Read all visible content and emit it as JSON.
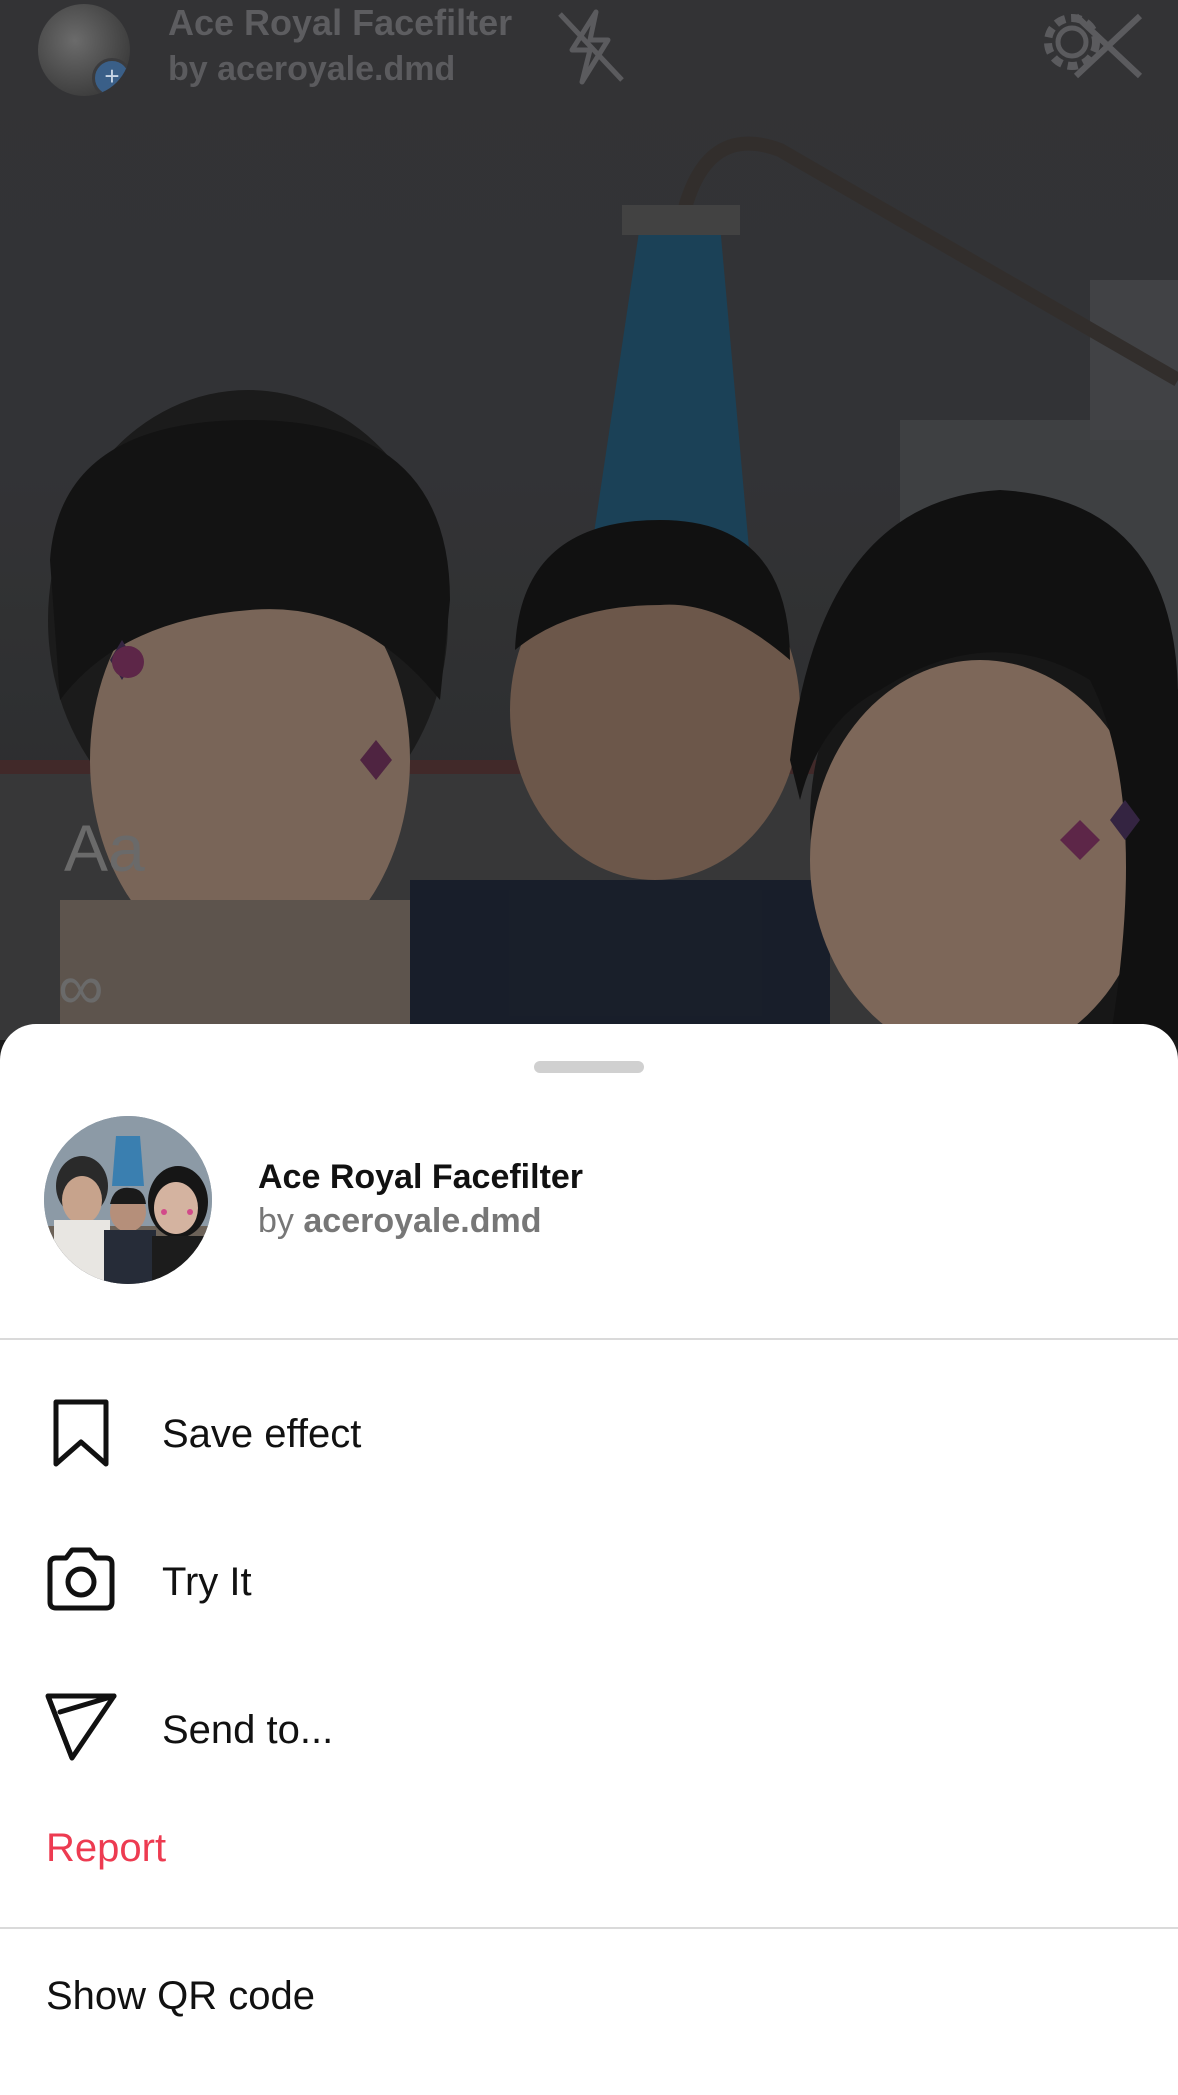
{
  "header": {
    "effect_title": "Ace Royal Facefilter",
    "effect_byline": "by aceroyale.dmd"
  },
  "preview": {
    "text_tool": "Aa",
    "loop_tool": "∞"
  },
  "sheet": {
    "effect_name": "Ace Royal Facefilter",
    "by_prefix": "by",
    "creator": "aceroyale.dmd",
    "menu": [
      {
        "label": "Save effect",
        "icon": "bookmark-icon"
      },
      {
        "label": "Try It",
        "icon": "camera-icon"
      },
      {
        "label": "Send to...",
        "icon": "send-icon"
      }
    ],
    "report_label": "Report",
    "qr_label": "Show QR code"
  },
  "colors": {
    "report": "#ed3b51",
    "sheet_bg": "#ffffff",
    "divider": "#dadada"
  }
}
